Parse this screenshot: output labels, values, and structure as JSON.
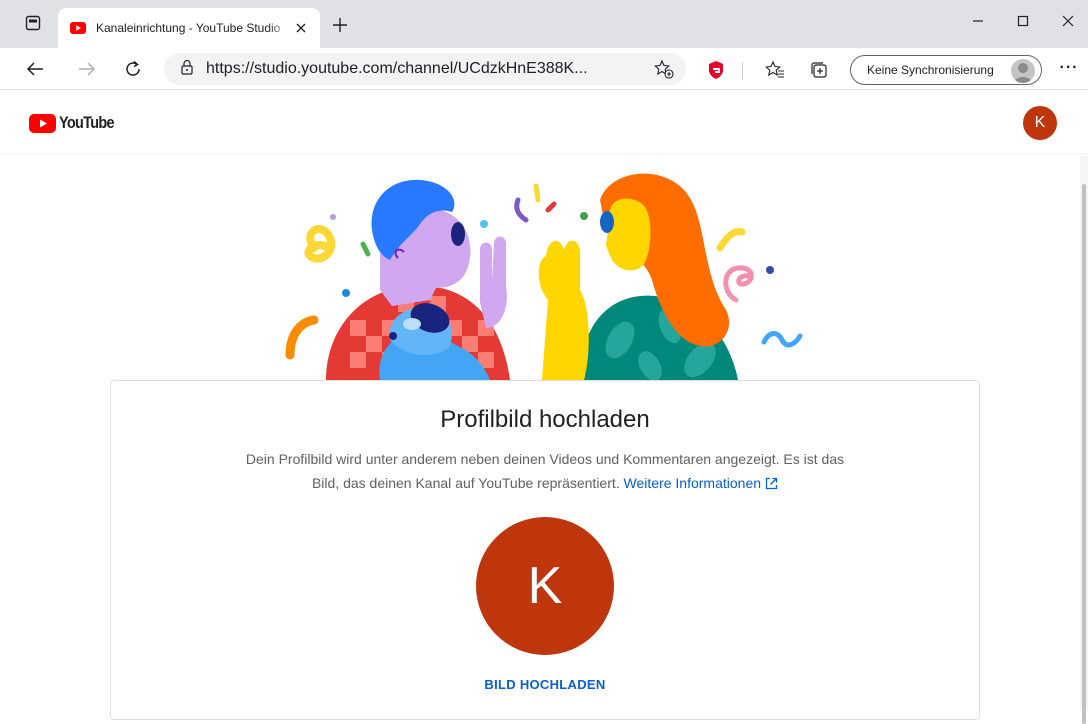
{
  "browser": {
    "tab_title": "Kanaleinrichtung - YouTube Studio",
    "url": "https://studio.youtube.com/channel/UCdzkHnE388K...",
    "sync_label": "Keine Synchronisierung",
    "accent": "#ff0000"
  },
  "youtube": {
    "logo_text": "YouTube",
    "avatar_letter": "K",
    "avatar_color": "#bf360c"
  },
  "card": {
    "title": "Profilbild hochladen",
    "desc_line1": "Dein Profilbild wird unter anderem neben deinen Videos und Kommentaren angezeigt. Es ist das",
    "desc_line2": "Bild, das deinen Kanal auf YouTube repräsentiert.",
    "learn_more": "Weitere Informationen",
    "avatar_letter": "K",
    "upload_label": "BILD HOCHLADEN",
    "link_color": "#065fd4"
  }
}
